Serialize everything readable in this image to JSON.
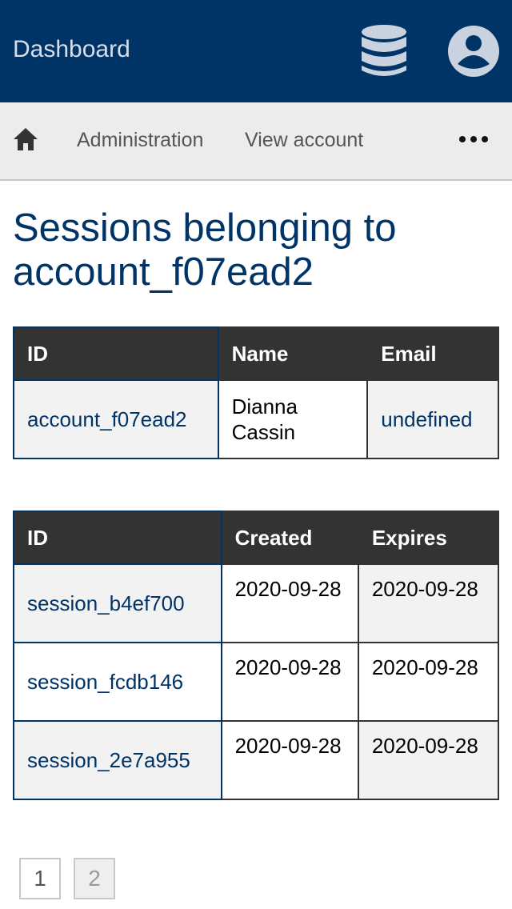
{
  "header": {
    "title": "Dashboard",
    "icons": {
      "database": "database-icon",
      "user": "user-circle-icon"
    },
    "colors": {
      "background": "#003366",
      "title": "#d6deea",
      "icon": "#c9d3e0"
    }
  },
  "nav": {
    "home_icon": "home-icon",
    "items": [
      {
        "label": "Administration"
      },
      {
        "label": "View account"
      }
    ],
    "more_icon": "more-horizontal-icon"
  },
  "page": {
    "heading": "Sessions belonging to account_f07ead2"
  },
  "account_table": {
    "headers": [
      "ID",
      "Name",
      "Email"
    ],
    "rows": [
      {
        "id": "account_f07ead2",
        "name": "Dianna Cassin",
        "email": "undefined"
      }
    ]
  },
  "sessions_table": {
    "headers": [
      "ID",
      "Created",
      "Expires"
    ],
    "rows": [
      {
        "id": "session_b4ef700",
        "created": "2020-09-28",
        "expires": "2020-09-28"
      },
      {
        "id": "session_fcdb146",
        "created": "2020-09-28",
        "expires": "2020-09-28"
      },
      {
        "id": "session_2e7a955",
        "created": "2020-09-28",
        "expires": "2020-09-28"
      }
    ]
  },
  "pagination": {
    "pages": [
      "1",
      "2"
    ],
    "current": "2"
  }
}
